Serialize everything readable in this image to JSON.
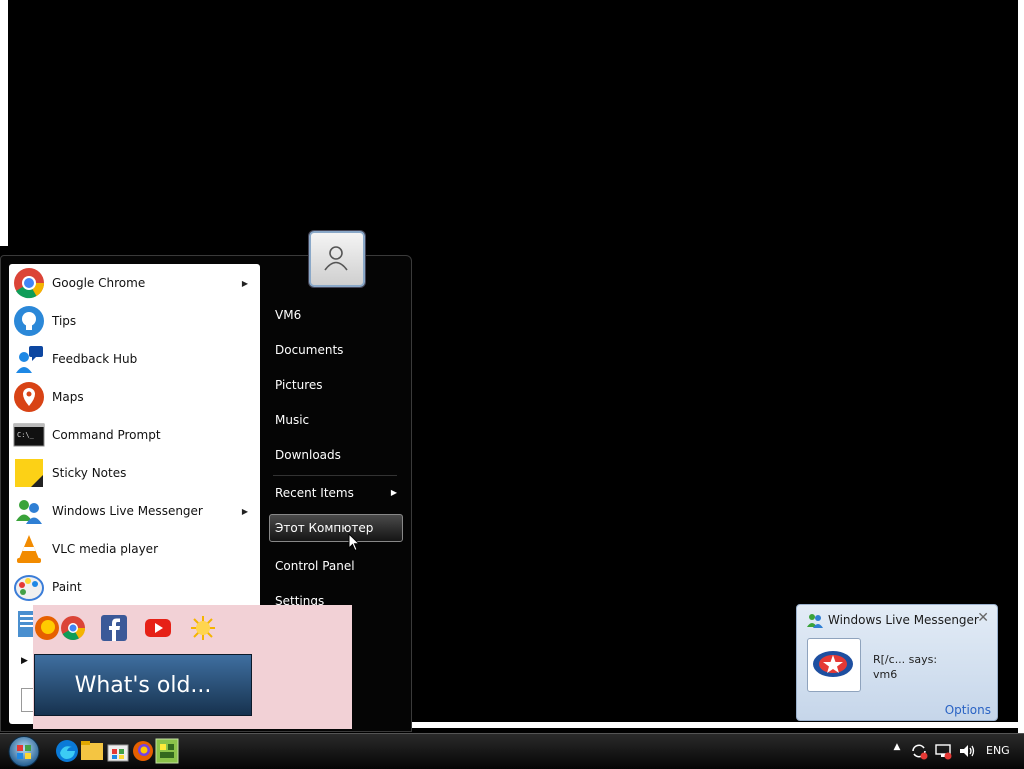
{
  "start_menu": {
    "programs": [
      {
        "label": "Google Chrome",
        "icon": "chrome-icon",
        "has_submenu": true
      },
      {
        "label": "Tips",
        "icon": "tips-icon",
        "has_submenu": false
      },
      {
        "label": "Feedback Hub",
        "icon": "feedback-hub-icon",
        "has_submenu": false
      },
      {
        "label": "Maps",
        "icon": "maps-icon",
        "has_submenu": false
      },
      {
        "label": "Command Prompt",
        "icon": "command-prompt-icon",
        "has_submenu": false
      },
      {
        "label": "Sticky Notes",
        "icon": "sticky-notes-icon",
        "has_submenu": false
      },
      {
        "label": "Windows Live Messenger",
        "icon": "messenger-icon",
        "has_submenu": true
      },
      {
        "label": "VLC media player",
        "icon": "vlc-icon",
        "has_submenu": false
      },
      {
        "label": "Paint",
        "icon": "paint-icon",
        "has_submenu": false
      }
    ],
    "right_items": [
      {
        "label": "VM6"
      },
      {
        "label": "Documents"
      },
      {
        "label": "Pictures"
      },
      {
        "label": "Music"
      },
      {
        "label": "Downloads"
      },
      {
        "label": "Recent Items",
        "has_submenu": true
      },
      {
        "label": "Этот Компютер",
        "highlighted": true
      },
      {
        "label": "Control Panel"
      },
      {
        "label": "Settings"
      }
    ],
    "cmd_icon_text": "C:\\_"
  },
  "overlay": {
    "button_label": "What's old...",
    "icons": [
      "firefox-icon",
      "chrome-icon",
      "facebook-icon",
      "youtube-icon",
      "sun-icon"
    ]
  },
  "notification": {
    "title": "Windows Live Messenger",
    "sender_line": "R[/c... says:",
    "message": "vm6",
    "options_label": "Options",
    "close_glyph": "✕"
  },
  "taskbar": {
    "language": "ENG",
    "pinned": [
      "edge-icon",
      "file-explorer-icon",
      "store-icon",
      "firefox-icon",
      "app-icon"
    ],
    "tray": [
      "show-hidden-icon",
      "sync-icon",
      "network-icon",
      "volume-icon"
    ]
  },
  "colors": {
    "accent_link": "#2a63c4",
    "menu_background": "#050505",
    "overlay_pink": "#f2d1d6"
  }
}
